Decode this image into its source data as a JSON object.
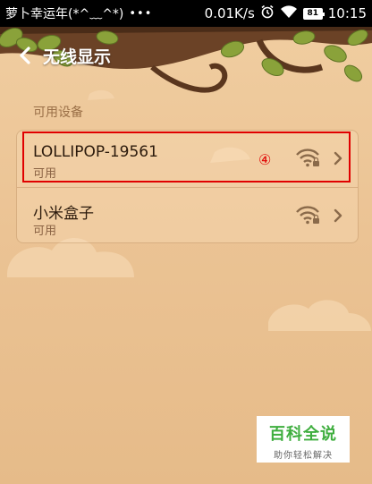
{
  "status_bar": {
    "carrier": "萝卜幸运年(*^﹏^*)",
    "dots": "•••",
    "speed": "0.01K/s",
    "battery": "81",
    "time": "10:15",
    "icons": [
      "alarm-icon",
      "wifi-icon",
      "battery-icon"
    ]
  },
  "header": {
    "title": "无线显示",
    "back_icon": "chevron-left-icon"
  },
  "section": {
    "label": "可用设备",
    "devices": [
      {
        "name": "LOLLIPOP-19561",
        "status": "可用",
        "icon": "wifi-lock-icon"
      },
      {
        "name": "小米盒子",
        "status": "可用",
        "icon": "wifi-lock-icon"
      }
    ]
  },
  "annotation": {
    "step": "④",
    "color": "#e00000"
  },
  "watermark": {
    "title": "百科全说",
    "subtitle": "助你轻松解决"
  },
  "colors": {
    "background": "#ecc596",
    "title_text": "#ffffff",
    "accent_green": "#3fae3f"
  }
}
